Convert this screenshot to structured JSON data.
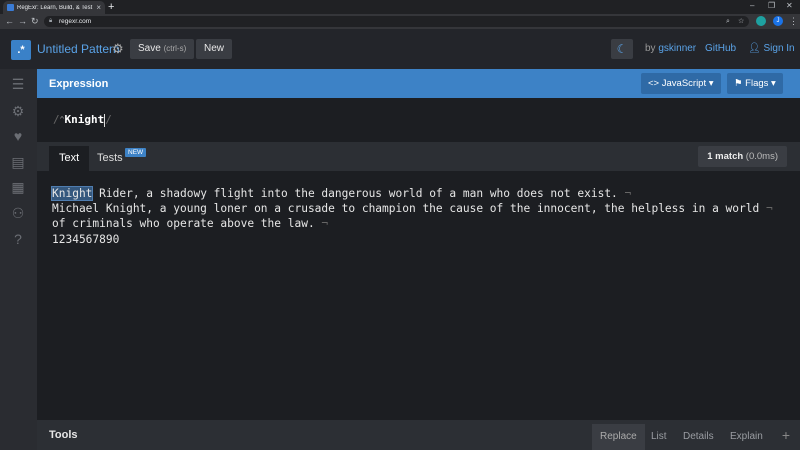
{
  "browser": {
    "tab_title": "RegExr: Learn, Build, & Test RegE",
    "url": "regexr.com",
    "new_tab": "+",
    "profile_initial": "J"
  },
  "header": {
    "pattern_title": "Untitled Pattern",
    "save_label": "Save",
    "save_shortcut": "(ctrl-s)",
    "new_label": "New",
    "by_label": "by",
    "author": "gskinner",
    "github_label": "GitHub",
    "signin_label": "Sign In"
  },
  "expression": {
    "title": "Expression",
    "flavor_label": "JavaScript ▾",
    "flags_label": "Flags ▾",
    "delim_open": "/",
    "anchor": "^",
    "pattern": "Knight",
    "delim_close": "/"
  },
  "text_panel": {
    "tab_text": "Text",
    "tab_tests": "Tests",
    "tests_badge": "NEW",
    "match_count": "1 match",
    "match_time": "(0.0ms)",
    "lines": [
      "Knight Rider, a shadowy flight into the dangerous world of a man who does not exist.",
      "Michael Knight, a young loner on a crusade to champion the cause of the innocent, the helpless in a world",
      "of criminals who operate above the law.",
      "1234567890"
    ],
    "highlight": "Knight"
  },
  "tools": {
    "title": "Tools",
    "tabs": [
      "Replace",
      "List",
      "Details",
      "Explain"
    ],
    "add_label": "+"
  },
  "sidebar": {
    "icons": [
      "menu-icon",
      "settings-icon",
      "favorites-icon",
      "cheatsheet-icon",
      "reference-icon",
      "community-icon",
      "help-icon"
    ]
  }
}
